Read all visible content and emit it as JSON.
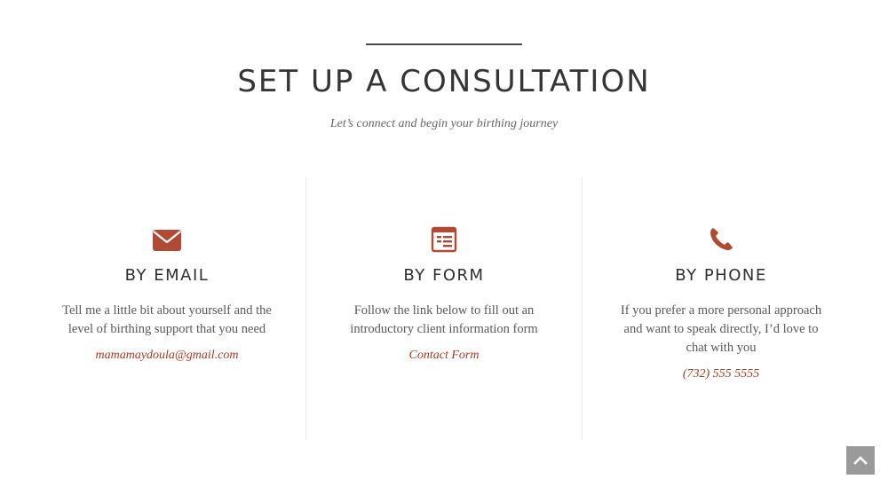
{
  "section": {
    "title": "SET UP A CONSULTATION",
    "subtitle": "Let’s connect and begin your birthing journey"
  },
  "accent_color": "#b04a35",
  "columns": [
    {
      "icon": "envelope-icon",
      "title": "BY EMAIL",
      "body": "Tell me a little bit about yourself and the level of birthing support that you need",
      "link": "mamamaydoula@gmail.com"
    },
    {
      "icon": "form-icon",
      "title": "BY FORM",
      "body": "Follow the link below to fill out an introductory client information form",
      "link": "Contact Form"
    },
    {
      "icon": "phone-icon",
      "title": "BY PHONE",
      "body": "If you prefer a more personal approach and want to speak directly, I’d love to chat with you",
      "link": "(732) 555 5555"
    }
  ],
  "scroll_top": {
    "icon": "chevron-up-icon"
  }
}
